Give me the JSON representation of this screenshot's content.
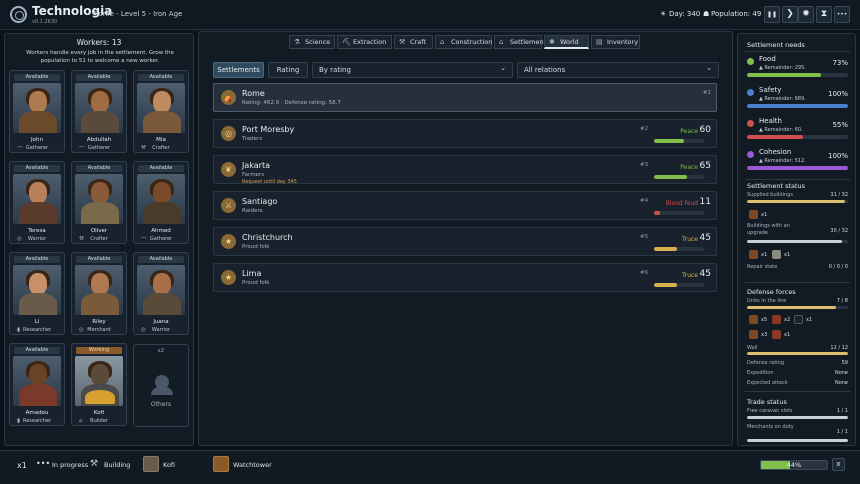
{
  "header": {
    "title": "Technologia",
    "version": "v0.1.2630",
    "location": "Rome - Level 5 - Iron Age",
    "day": "Day: 340",
    "population": "Population: 49",
    "buttons": {
      "pause": "❚❚",
      "next": "❯",
      "gear": "✹",
      "hourglass": "⧗",
      "menu": "•••"
    }
  },
  "workers": {
    "title": "Workers: 13",
    "description": "Workers handle every job in the settlement. Grow the population to 51 to welcome a new worker.",
    "list": [
      {
        "status": "Available",
        "name": "John",
        "role": "Gatherer",
        "icon": "⌒"
      },
      {
        "status": "Available",
        "name": "Abdullah",
        "role": "Gatherer",
        "icon": "⌒"
      },
      {
        "status": "Available",
        "name": "Mia",
        "role": "Crafter",
        "icon": "⚒"
      },
      {
        "status": "Available",
        "name": "Teresa",
        "role": "Warrior",
        "icon": "◎"
      },
      {
        "status": "Available",
        "name": "Oliver",
        "role": "Crafter",
        "icon": "⚒"
      },
      {
        "status": "Available",
        "name": "Ahmed",
        "role": "Gatherer",
        "icon": "⌒"
      },
      {
        "status": "Available",
        "name": "Li",
        "role": "Researcher",
        "icon": "▮"
      },
      {
        "status": "Available",
        "name": "Riley",
        "role": "Merchant",
        "icon": "◎"
      },
      {
        "status": "Available",
        "name": "Juana",
        "role": "Warrior",
        "icon": "◎"
      },
      {
        "status": "Available",
        "name": "Amadou",
        "role": "Researcher",
        "icon": "▮"
      },
      {
        "status": "Working",
        "name": "Kofi",
        "role": "Builder",
        "icon": "⌂"
      }
    ],
    "others": {
      "count": "x2",
      "label": "Others"
    }
  },
  "tabs": [
    {
      "label": "Science",
      "icon": "⚗"
    },
    {
      "label": "Extraction",
      "icon": "⛏"
    },
    {
      "label": "Craft",
      "icon": "⚒"
    },
    {
      "label": "Construction",
      "icon": "⌂"
    },
    {
      "label": "Settlement",
      "icon": "⌂"
    },
    {
      "label": "World",
      "icon": "✺",
      "active": true
    },
    {
      "label": "Inventory",
      "icon": "▤"
    }
  ],
  "filters": {
    "settlements": "Settlements",
    "rating": "Rating",
    "sort": "By rating",
    "relations": "All relations",
    "caret": "⌄"
  },
  "settlements": [
    {
      "name": "Rome",
      "desc": "Rating: 462.9 · Defense rating: 58.7",
      "rank": "#1",
      "relation": "",
      "value": "",
      "icon": "⛺",
      "selected": true
    },
    {
      "name": "Port Moresby",
      "desc": "Traders",
      "rank": "#2",
      "relation": "Peace",
      "value": "60",
      "icon": "◎",
      "barColor": "#7fbf4a",
      "barPct": 60
    },
    {
      "name": "Jakarta",
      "desc": "Farmers",
      "note": "Request until day 345",
      "rank": "#3",
      "relation": "Peace",
      "value": "65",
      "icon": "❦",
      "barColor": "#7fbf4a",
      "barPct": 65
    },
    {
      "name": "Santiago",
      "desc": "Raiders",
      "rank": "#4",
      "relation": "Blood feud",
      "value": "11",
      "icon": "⚔",
      "barColor": "#d05050",
      "barPct": 11
    },
    {
      "name": "Christchurch",
      "desc": "Proud folk",
      "rank": "#5",
      "relation": "Truce",
      "value": "45",
      "icon": "★",
      "barColor": "#d8b050",
      "barPct": 45
    },
    {
      "name": "Lima",
      "desc": "Proud folk",
      "rank": "#6",
      "relation": "Truce",
      "value": "45",
      "icon": "★",
      "barColor": "#d8b050",
      "barPct": 45
    }
  ],
  "needs": {
    "title": "Settlement needs",
    "items": [
      {
        "name": "Food",
        "remainder": "▲ Remainder: 295.",
        "value": "73%",
        "pct": 73,
        "color": "#7fbf4a"
      },
      {
        "name": "Safety",
        "remainder": "▲ Remainder: 689.",
        "value": "100%",
        "pct": 100,
        "color": "#4a7fd0"
      },
      {
        "name": "Health",
        "remainder": "▲ Remainder: 60.",
        "value": "55%",
        "pct": 55,
        "color": "#d05050"
      },
      {
        "name": "Cohesion",
        "remainder": "▲ Remainder: 512.",
        "value": "100%",
        "pct": 100,
        "color": "#9b59d6"
      }
    ]
  },
  "status": {
    "title": "Settlement status",
    "supplied": {
      "label": "Supplied buildings",
      "value": "31 / 32",
      "pct": 97
    },
    "supplied_icon": "x1",
    "upgrade": {
      "label": "Buildings with an upgrade",
      "value": "30 / 32",
      "pct": 94
    },
    "upgrade_icons": [
      "x1",
      "x1"
    ],
    "repair": {
      "label": "Repair state",
      "value": "0 / 0 / 0"
    }
  },
  "defense": {
    "title": "Defense forces",
    "units": {
      "label": "Units in the line",
      "value": "7 / 8",
      "pct": 88
    },
    "unit_counts": [
      "x5",
      "x2",
      "x1",
      "x3",
      "x1"
    ],
    "wall": {
      "label": "Wall",
      "value": "12 / 12",
      "pct": 100
    },
    "rating": {
      "label": "Defense rating",
      "value": "59"
    },
    "expedition": {
      "label": "Expedition",
      "value": "None"
    },
    "attack": {
      "label": "Expected attack",
      "value": "None"
    }
  },
  "trade": {
    "title": "Trade status",
    "caravan": {
      "label": "Free caravan slots",
      "value": "1 / 1",
      "pct": 100
    },
    "merchants": {
      "label": "Merchants on duty",
      "value": "1 / 1",
      "pct": 100
    }
  },
  "bottom": {
    "multiplier": "x1",
    "progress_label": "In progress",
    "building_label": "Building",
    "worker": "Kofi",
    "target": "Watchtower",
    "percent": "44%",
    "pct": 44,
    "close": "x"
  }
}
